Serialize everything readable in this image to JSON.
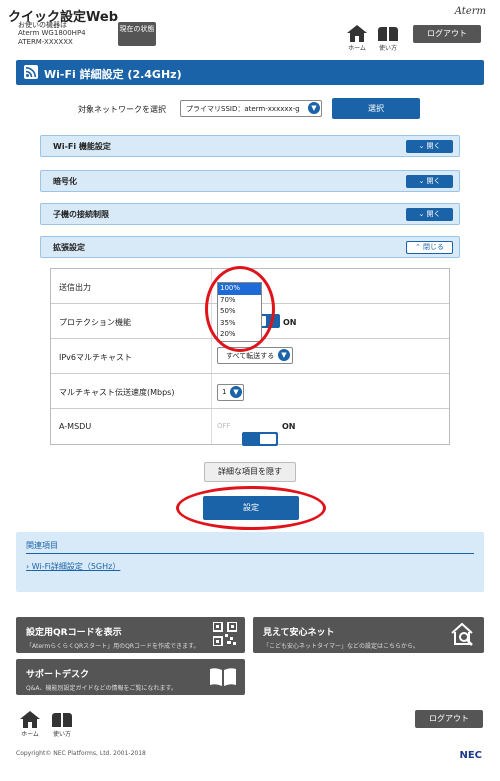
{
  "header": {
    "app_title": "クイック設定Web",
    "device_label": "お使いの機器は",
    "device_model": "Aterm WG1800HP4",
    "device_name": "ATERM-XXXXXX",
    "status_button": "現在の状態",
    "brand": "Aterm",
    "home_label": "ホーム",
    "manual_label": "使い方",
    "logout_label": "ログアウト"
  },
  "section": {
    "title": "Wi-Fi 詳細設定 (2.4GHz)"
  },
  "network_select": {
    "label": "対象ネットワークを選択",
    "value": "プライマリSSID：aterm-xxxxxx-g",
    "button": "選択"
  },
  "accordions": [
    {
      "label": "Wi-Fi 機能設定",
      "button": "開く"
    },
    {
      "label": "暗号化",
      "button": "開く"
    },
    {
      "label": "子機の接続制限",
      "button": "開く"
    },
    {
      "label": "拡張設定",
      "button": "閉じる"
    }
  ],
  "extended": {
    "rows": [
      {
        "label": "送信出力"
      },
      {
        "label": "プロテクション機能"
      },
      {
        "label": "IPv6マルチキャスト"
      },
      {
        "label": "マルチキャスト伝送速度(Mbps)"
      },
      {
        "label": "A-MSDU"
      }
    ],
    "tx_power_options": [
      "100%",
      "70%",
      "50%",
      "35%",
      "20%"
    ],
    "tx_power_selected": "100%",
    "protection_on_label": "ON",
    "ipv6_value": "すべて転送する",
    "multicast_rate_value": "1",
    "amsdu_off": "OFF",
    "amsdu_on": "ON"
  },
  "hide_detail_button": "詳細な項目を隠す",
  "submit_button": "設定",
  "related": {
    "title": "関連項目",
    "link": "Wi-Fi詳細設定（5GHz）"
  },
  "tiles": {
    "qr": {
      "title": "設定用QRコードを表示",
      "desc": "「AtermらくらくQRスタート」用のQRコードを作成できます。"
    },
    "safe": {
      "title": "見えて安心ネット",
      "desc": "「こども安心ネットタイマー」などの設定はこちらから。"
    },
    "support": {
      "title": "サポートデスク",
      "desc": "Q&A、機能別設定ガイドなどの情報をご覧になれます。"
    }
  },
  "footer": {
    "home_label": "ホーム",
    "manual_label": "使い方",
    "logout_label": "ログアウト",
    "copyright": "Copyright© NEC Platforms, Ltd. 2001-2018",
    "nec_logo": "NEC"
  },
  "colors": {
    "primary": "#1b63a8",
    "dark": "#555555",
    "highlight": "#e0131b",
    "panel": "#d8eaf8"
  }
}
